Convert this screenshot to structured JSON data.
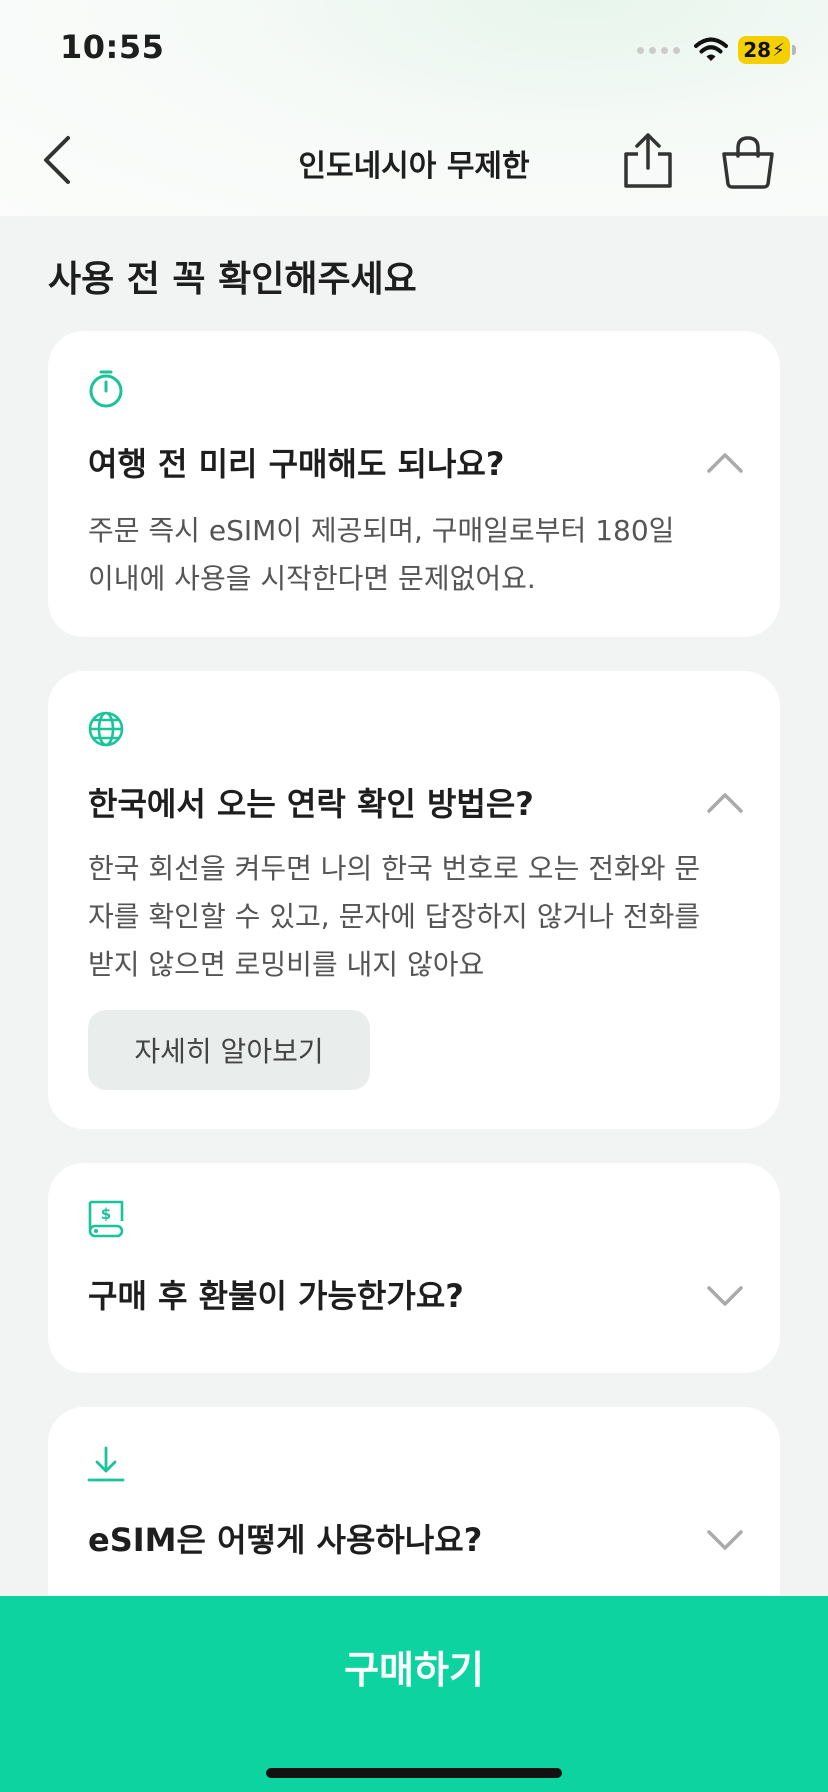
{
  "status_bar": {
    "time": "10:55",
    "battery": "28"
  },
  "nav": {
    "title": "인도네시아 무제한"
  },
  "section": {
    "title": "사용 전 꼭 확인해주세요"
  },
  "faq": [
    {
      "icon": "timer-icon",
      "question": "여행 전 미리 구매해도 되나요?",
      "expanded": true,
      "answer_lines": [
        "주문 즉시 eSIM이 제공되며, 구매일로부터 180일",
        "이내에 사용을 시작한다면 문제없어요."
      ]
    },
    {
      "icon": "globe-icon",
      "question": "한국에서 오는 연락 확인 방법은?",
      "expanded": true,
      "answer_lines": [
        "한국 회선을 켜두면 나의 한국 번호로 오는 전화와 문",
        "자를 확인할 수 있고, 문자에 답장하지 않거나 전화를",
        "받지 않으면 로밍비를 내지 않아요"
      ],
      "button_label": "자세히 알아보기"
    },
    {
      "icon": "refund-receipt-icon",
      "question": "구매 후 환불이 가능한가요?",
      "expanded": false
    },
    {
      "icon": "download-icon",
      "question": "eSIM은 어떻게 사용하나요?",
      "expanded": false
    }
  ],
  "footer": {
    "buy_label": "구매하기"
  },
  "colors": {
    "accent": "#0cd3a0",
    "icon": "#19c49a",
    "battery": "#f5d000"
  }
}
